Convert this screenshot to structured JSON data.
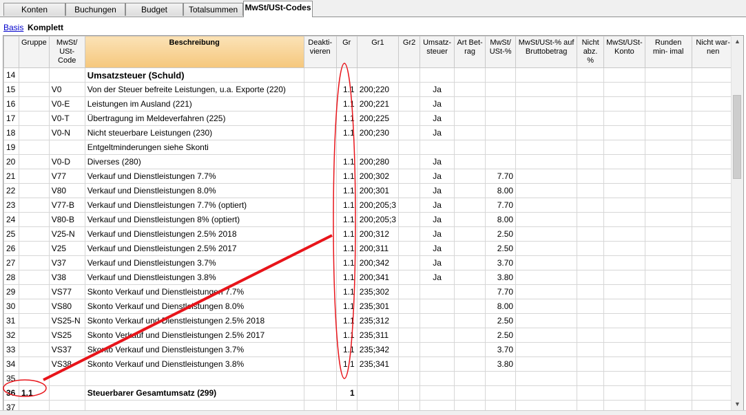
{
  "tabs": [
    {
      "label": "Konten",
      "active": false
    },
    {
      "label": "Buchungen",
      "active": false
    },
    {
      "label": "Budget",
      "active": false
    },
    {
      "label": "Totalsummen",
      "active": false
    },
    {
      "label": "MwSt/USt-Codes",
      "active": true
    }
  ],
  "views": {
    "basis": "Basis",
    "komplett": "Komplett"
  },
  "columns": {
    "gruppe": "Gruppe",
    "code": "MwSt/ USt-Code",
    "beschreibung": "Beschreibung",
    "deaktivieren": "Deakti- vieren",
    "gr": "Gr",
    "gr1": "Gr1",
    "gr2": "Gr2",
    "umsatz": "Umsatz- steuer",
    "artbetrag": "Art Bet- rag",
    "pct": "MwSt/ USt-%",
    "brutto": "MwSt/USt-% auf Bruttobetrag",
    "nichtabz": "Nicht abz. %",
    "konto": "MwSt/USt- Konto",
    "runden": "Runden min- imal",
    "nichtwarnen": "Nicht war- nen"
  },
  "rows": [
    {
      "n": "14",
      "gruppe": "",
      "code": "",
      "desc": "Umsatzsteuer (Schuld)",
      "gr": "",
      "gr1": "",
      "umsatz": "",
      "pct": "",
      "style": "header"
    },
    {
      "n": "15",
      "gruppe": "",
      "code": "V0",
      "desc": "Von der Steuer befreite Leistungen, u.a. Exporte (220)",
      "gr": "1.1",
      "gr1": "200;220",
      "umsatz": "Ja",
      "pct": ""
    },
    {
      "n": "16",
      "gruppe": "",
      "code": "V0-E",
      "desc": "Leistungen im Ausland (221)",
      "gr": "1.1",
      "gr1": "200;221",
      "umsatz": "Ja",
      "pct": ""
    },
    {
      "n": "17",
      "gruppe": "",
      "code": "V0-T",
      "desc": "Übertragung im Meldeverfahren (225)",
      "gr": "1.1",
      "gr1": "200;225",
      "umsatz": "Ja",
      "pct": ""
    },
    {
      "n": "18",
      "gruppe": "",
      "code": "V0-N",
      "desc": "Nicht steuerbare Leistungen (230)",
      "gr": "1.1",
      "gr1": "200;230",
      "umsatz": "Ja",
      "pct": ""
    },
    {
      "n": "19",
      "gruppe": "",
      "code": "",
      "desc": "Entgeltminderungen siehe Skonti",
      "gr": "",
      "gr1": "",
      "umsatz": "",
      "pct": ""
    },
    {
      "n": "20",
      "gruppe": "",
      "code": "V0-D",
      "desc": "Diverses (280)",
      "gr": "1.1",
      "gr1": "200;280",
      "umsatz": "Ja",
      "pct": ""
    },
    {
      "n": "21",
      "gruppe": "",
      "code": "V77",
      "desc": "Verkauf und Dienstleistungen 7.7%",
      "gr": "1.1",
      "gr1": "200;302",
      "umsatz": "Ja",
      "pct": "7.70"
    },
    {
      "n": "22",
      "gruppe": "",
      "code": "V80",
      "desc": "Verkauf und Dienstleistungen 8.0%",
      "gr": "1.1",
      "gr1": "200;301",
      "umsatz": "Ja",
      "pct": "8.00"
    },
    {
      "n": "23",
      "gruppe": "",
      "code": "V77-B",
      "desc": "Verkauf und Dienstleistungen 7.7% (optiert)",
      "gr": "1.1",
      "gr1": "200;205;3",
      "umsatz": "Ja",
      "pct": "7.70"
    },
    {
      "n": "24",
      "gruppe": "",
      "code": "V80-B",
      "desc": "Verkauf und Dienstleistungen 8% (optiert)",
      "gr": "1.1",
      "gr1": "200;205;3",
      "umsatz": "Ja",
      "pct": "8.00"
    },
    {
      "n": "25",
      "gruppe": "",
      "code": "V25-N",
      "desc": "Verkauf und Dienstleistungen 2.5% 2018",
      "gr": "1.1",
      "gr1": "200;312",
      "umsatz": "Ja",
      "pct": "2.50"
    },
    {
      "n": "26",
      "gruppe": "",
      "code": "V25",
      "desc": "Verkauf und Dienstleistungen 2.5% 2017",
      "gr": "1.1",
      "gr1": "200;311",
      "umsatz": "Ja",
      "pct": "2.50"
    },
    {
      "n": "27",
      "gruppe": "",
      "code": "V37",
      "desc": "Verkauf und Dienstleistungen 3.7%",
      "gr": "1.1",
      "gr1": "200;342",
      "umsatz": "Ja",
      "pct": "3.70"
    },
    {
      "n": "28",
      "gruppe": "",
      "code": "V38",
      "desc": "Verkauf und Dienstleistungen 3.8%",
      "gr": "1.1",
      "gr1": "200;341",
      "umsatz": "Ja",
      "pct": "3.80"
    },
    {
      "n": "29",
      "gruppe": "",
      "code": "VS77",
      "desc": "Skonto Verkauf und Dienstleistungen  7.7%",
      "gr": "1.1",
      "gr1": "235;302",
      "umsatz": "",
      "pct": "7.70"
    },
    {
      "n": "30",
      "gruppe": "",
      "code": "VS80",
      "desc": "Skonto Verkauf und Dienstleistungen  8.0%",
      "gr": "1.1",
      "gr1": "235;301",
      "umsatz": "",
      "pct": "8.00"
    },
    {
      "n": "31",
      "gruppe": "",
      "code": "VS25-N",
      "desc": "Skonto Verkauf und Dienstleistungen  2.5% 2018",
      "gr": "1.1",
      "gr1": "235;312",
      "umsatz": "",
      "pct": "2.50"
    },
    {
      "n": "32",
      "gruppe": "",
      "code": "VS25",
      "desc": "Skonto Verkauf und Dienstleistungen  2.5% 2017",
      "gr": "1.1",
      "gr1": "235;311",
      "umsatz": "",
      "pct": "2.50"
    },
    {
      "n": "33",
      "gruppe": "",
      "code": "VS37",
      "desc": "Skonto Verkauf und Dienstleistungen 3.7%",
      "gr": "1.1",
      "gr1": "235;342",
      "umsatz": "",
      "pct": "3.70"
    },
    {
      "n": "34",
      "gruppe": "",
      "code": "VS38",
      "desc": "Skonto Verkauf und Dienstleistungen 3.8%",
      "gr": "1.1",
      "gr1": "235;341",
      "umsatz": "",
      "pct": "3.80"
    },
    {
      "n": "35",
      "gruppe": "",
      "code": "",
      "desc": "",
      "gr": "",
      "gr1": "",
      "umsatz": "",
      "pct": ""
    },
    {
      "n": "36",
      "gruppe": "1.1",
      "code": "",
      "desc": "Steuerbarer Gesamtumsatz (299)",
      "gr": "1",
      "gr1": "",
      "umsatz": "",
      "pct": "",
      "style": "bold"
    },
    {
      "n": "37",
      "gruppe": "",
      "code": "",
      "desc": "",
      "gr": "",
      "gr1": "",
      "umsatz": "",
      "pct": ""
    }
  ],
  "annotation_color": "#e8141a"
}
